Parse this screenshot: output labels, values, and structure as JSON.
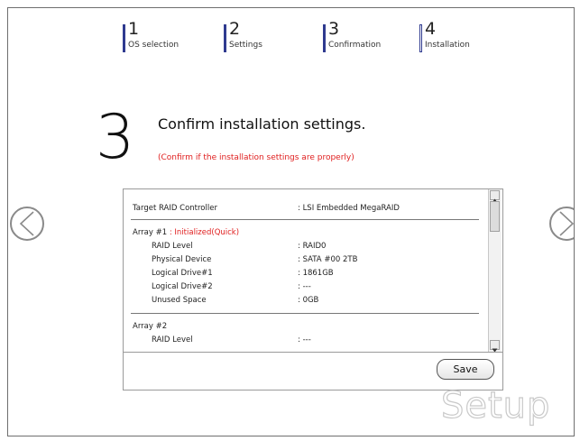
{
  "steps": [
    {
      "num": "1",
      "label": "OS selection"
    },
    {
      "num": "2",
      "label": "Settings"
    },
    {
      "num": "3",
      "label": "Confirmation"
    },
    {
      "num": "4",
      "label": "Installation"
    }
  ],
  "page": {
    "step_number": "3",
    "title": "Confirm installation settings.",
    "subtitle": "(Confirm if the installation settings are properly)"
  },
  "settings": {
    "controller": {
      "key": "Target RAID Controller",
      "value": ": LSI Embedded MegaRAID"
    },
    "array1": {
      "label": "Array #1",
      "status": ": Initialized(Quick)",
      "rows": [
        {
          "key": "RAID Level",
          "value": ": RAID0"
        },
        {
          "key": "Physical Device",
          "value": ": SATA #00 2TB"
        },
        {
          "key": "Logical Drive#1",
          "value": ": 1861GB"
        },
        {
          "key": "Logical Drive#2",
          "value": ": ---"
        },
        {
          "key": "Unused Space",
          "value": ": 0GB"
        }
      ]
    },
    "array2": {
      "label": "Array #2",
      "rows": [
        {
          "key": "RAID Level",
          "value": ": ---"
        }
      ]
    }
  },
  "buttons": {
    "save": "Save"
  },
  "brand": {
    "wordmark": "Setup"
  },
  "colors": {
    "accent": "#2f3a8f",
    "warning": "#e02020"
  }
}
